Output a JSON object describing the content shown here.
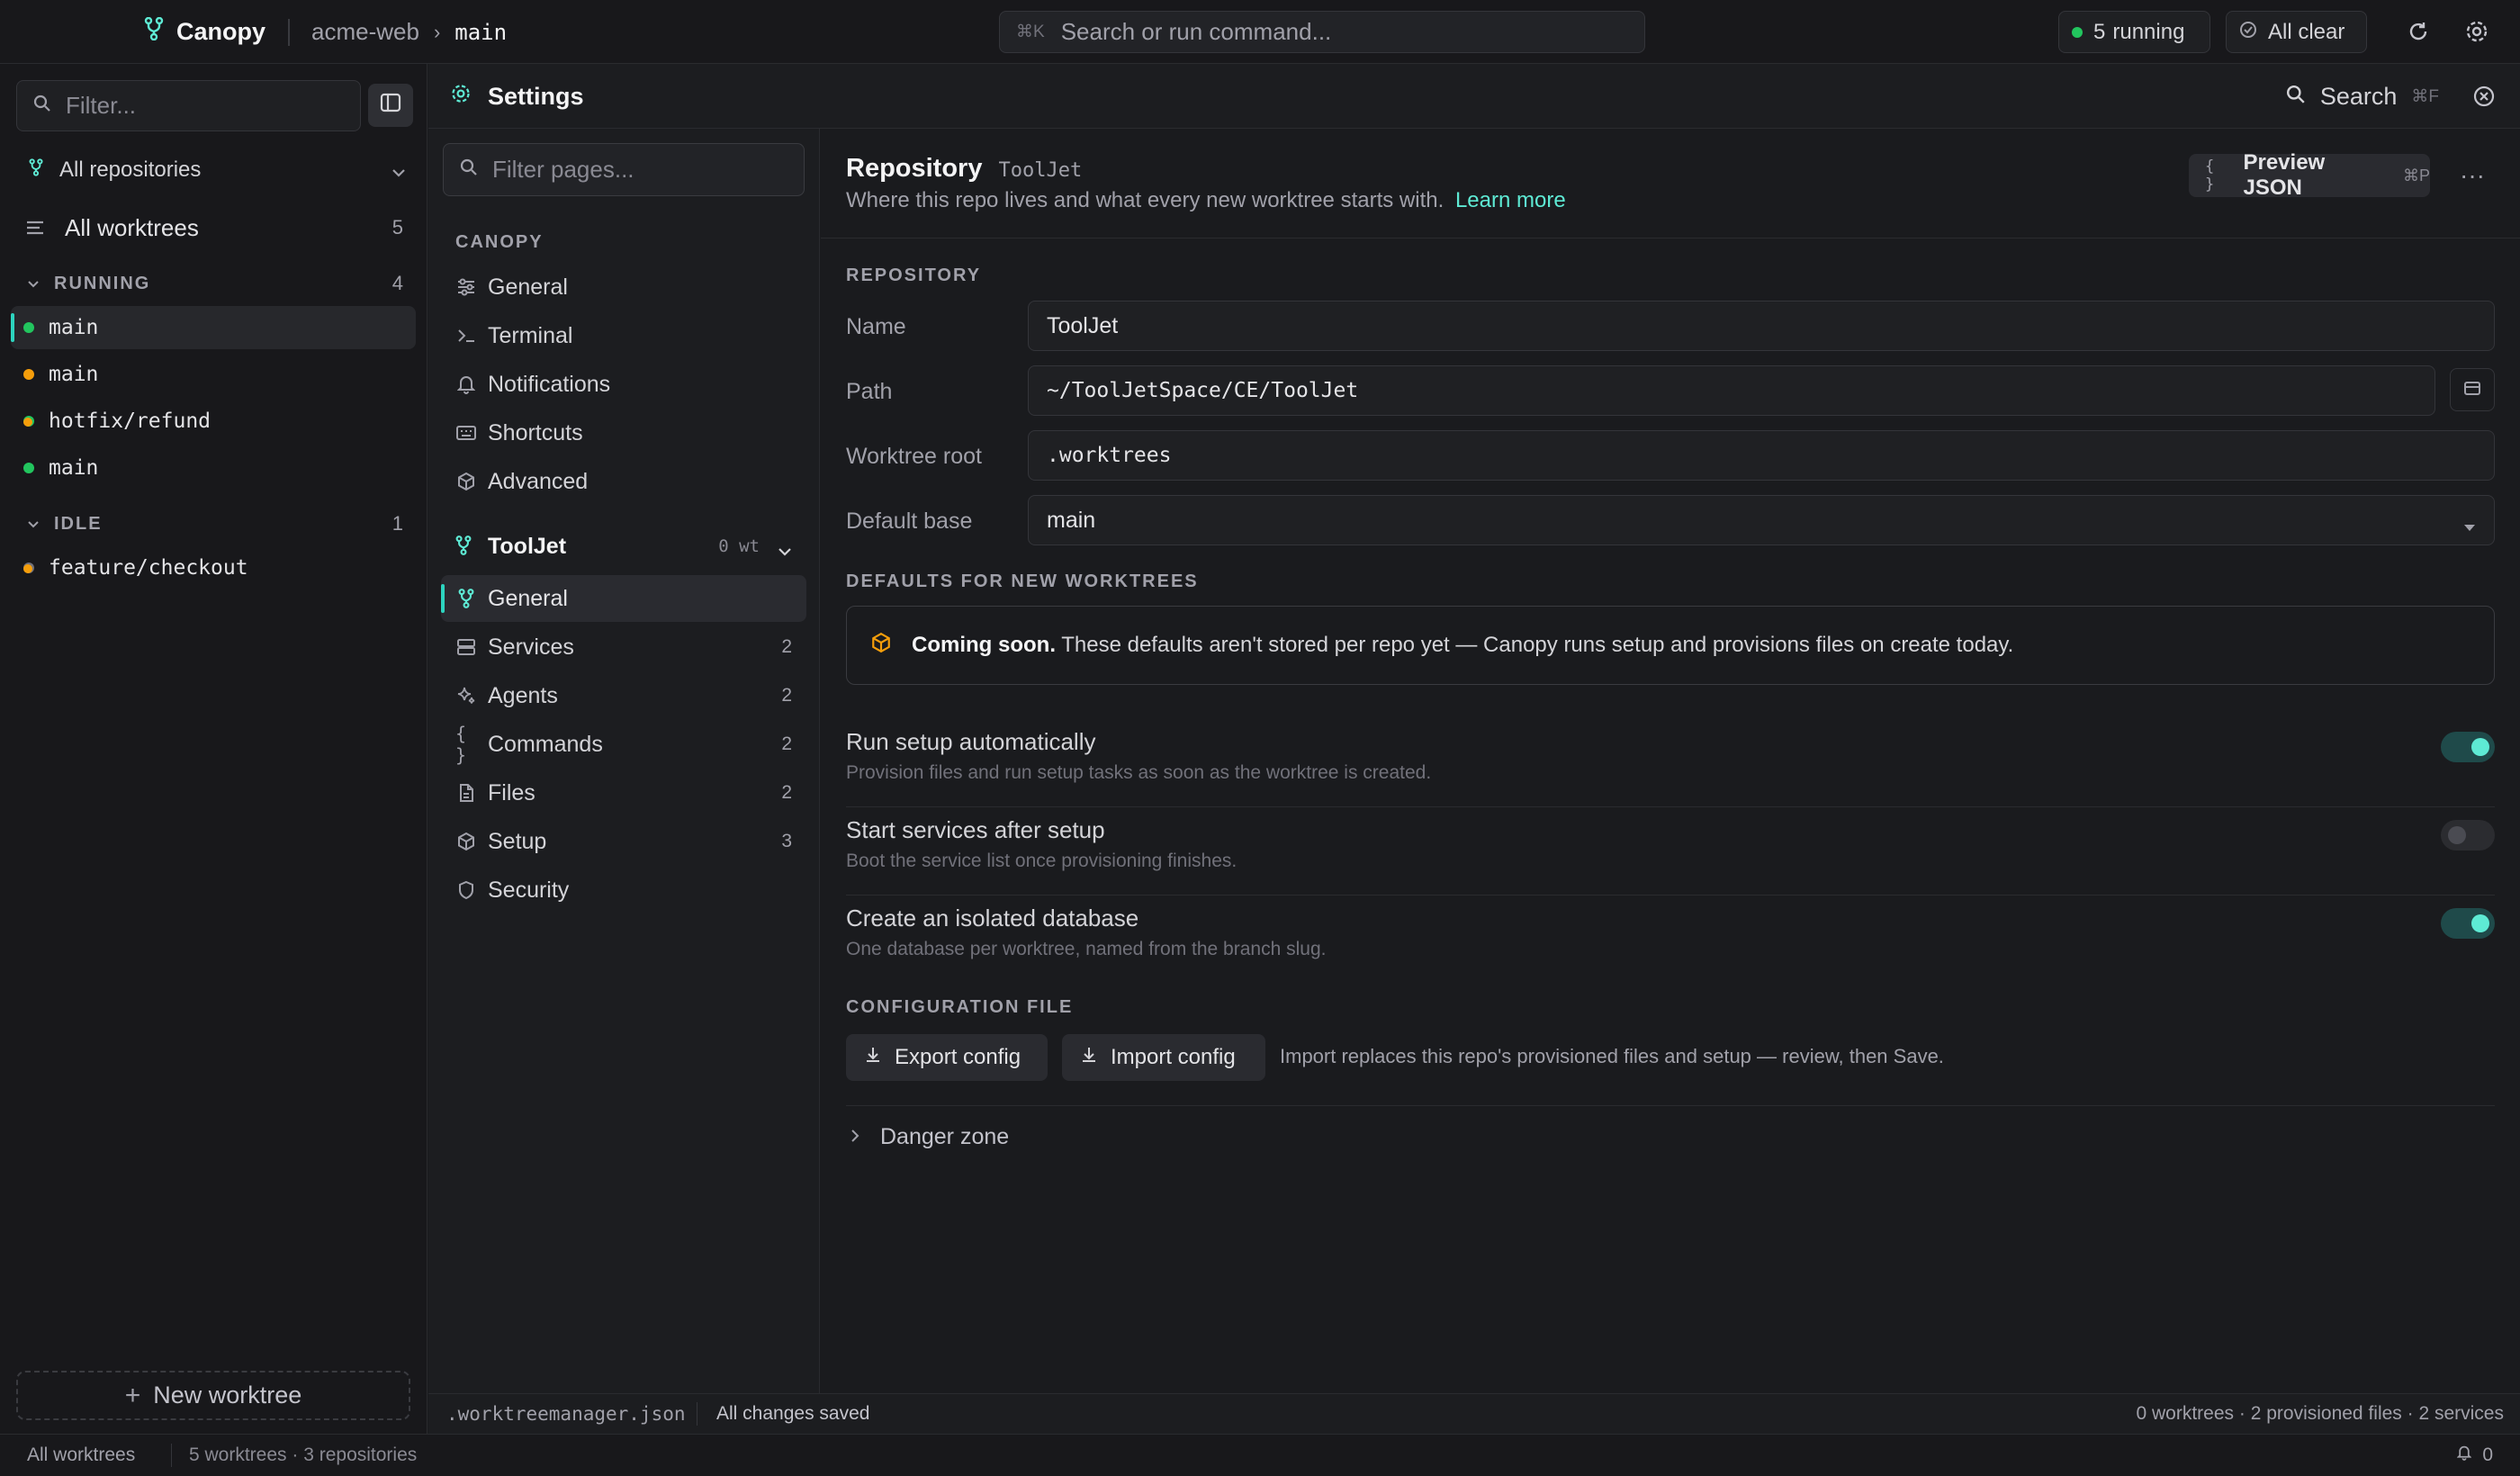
{
  "topbar": {
    "app_name": "Canopy",
    "repo": "acme-web",
    "branch": "main",
    "command": {
      "shortcut": "⌘K",
      "placeholder": "Search or run command..."
    },
    "running_count": "5",
    "running_label": "running",
    "status_label": "All clear"
  },
  "sidebar": {
    "filter_placeholder": "Filter...",
    "repos_label": "All repositories",
    "all_worktrees_label": "All worktrees",
    "all_worktrees_count": "5",
    "groups": [
      {
        "label": "RUNNING",
        "count": "4"
      },
      {
        "label": "IDLE",
        "count": "1"
      }
    ],
    "worktrees": [
      {
        "label": "main",
        "status": "running",
        "active": true
      },
      {
        "label": "main",
        "status": "starting"
      },
      {
        "label": "hotfix/refund",
        "status": "running",
        "modified": true
      },
      {
        "label": "main",
        "status": "running"
      },
      {
        "label": "feature/checkout",
        "status": "idle",
        "modified": true
      }
    ],
    "new_worktree_label": "New worktree"
  },
  "statusbar": {
    "left": "All worktrees",
    "mid": "5 worktrees · 3 repositories",
    "notifications": "0"
  },
  "settings": {
    "title": "Settings",
    "search_label": "Search",
    "search_shortcut": "⌘F",
    "nav": {
      "filter_placeholder": "Filter pages...",
      "section": "CANOPY",
      "global_items": [
        {
          "label": "General",
          "icon": "sliders-icon"
        },
        {
          "label": "Terminal",
          "icon": "terminal-icon"
        },
        {
          "label": "Notifications",
          "icon": "bell-icon"
        },
        {
          "label": "Shortcuts",
          "icon": "keyboard-icon"
        },
        {
          "label": "Advanced",
          "icon": "cube-icon"
        }
      ],
      "repo": {
        "label": "ToolJet",
        "worktrees": "0 wt"
      },
      "repo_items": [
        {
          "label": "General",
          "count": "",
          "active": true
        },
        {
          "label": "Services",
          "count": "2"
        },
        {
          "label": "Agents",
          "count": "2"
        },
        {
          "label": "Commands",
          "count": "2"
        },
        {
          "label": "Files",
          "count": "2"
        },
        {
          "label": "Setup",
          "count": "3"
        },
        {
          "label": "Security",
          "count": ""
        }
      ]
    },
    "footer": {
      "file": ".worktreemanager.json",
      "saved": "All changes saved",
      "stats": "0 worktrees · 2 provisioned files · 2 services"
    }
  },
  "content": {
    "title": "Repository",
    "subtitle": "ToolJet",
    "description": "Where this repo lives and what every new worktree starts with.",
    "learn_more": "Learn more",
    "preview_label": "Preview JSON",
    "preview_shortcut": "⌘P",
    "more_label": "···",
    "repository_section": "REPOSITORY",
    "fields": {
      "name_label": "Name",
      "name_value": "ToolJet",
      "path_label": "Path",
      "path_value": "~/ToolJetSpace/CE/ToolJet",
      "root_label": "Worktree root",
      "root_value": ".worktrees",
      "base_label": "Default base",
      "base_value": "main"
    },
    "defaults_section": "DEFAULTS FOR NEW WORKTREES",
    "notice_bold": "Coming soon.",
    "notice_text": "These defaults aren't stored per repo yet — Canopy runs setup and provisions files on create today.",
    "toggles": [
      {
        "title": "Run setup automatically",
        "desc": "Provision files and run setup tasks as soon as the worktree is created.",
        "on": true
      },
      {
        "title": "Start services after setup",
        "desc": "Boot the service list once provisioning finishes.",
        "on": false
      },
      {
        "title": "Create an isolated database",
        "desc": "One database per worktree, named from the branch slug.",
        "on": true
      }
    ],
    "config_section": "CONFIGURATION FILE",
    "export_label": "Export config",
    "import_label": "Import config",
    "import_note": "Import replaces this repo's provisioned files and setup — review, then Save.",
    "danger_label": "Danger zone"
  },
  "colors": {
    "accent": "#2dd4bf",
    "running": "#22c55e",
    "modified": "#f59e0b"
  }
}
